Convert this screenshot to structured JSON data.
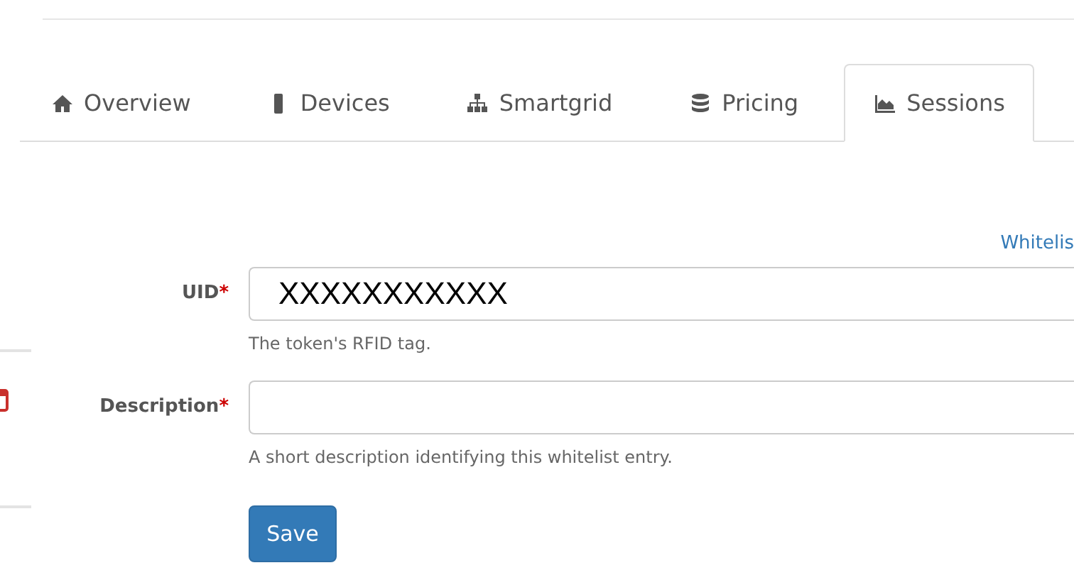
{
  "tabs": [
    {
      "label": "Overview",
      "selected": false
    },
    {
      "label": "Devices",
      "selected": false
    },
    {
      "label": "Smartgrid",
      "selected": false
    },
    {
      "label": "Pricing",
      "selected": false
    },
    {
      "label": "Sessions",
      "selected": true
    }
  ],
  "whitelist_link": "Whitelis",
  "fields": [
    {
      "label": "UID",
      "required_mark": "*",
      "value": "XXXXXXXXXXX",
      "help": "The token's RFID tag."
    },
    {
      "label": "Description",
      "required_mark": "*",
      "help": "A short description identifying this whitelist entry."
    }
  ],
  "save_button": "Save"
}
